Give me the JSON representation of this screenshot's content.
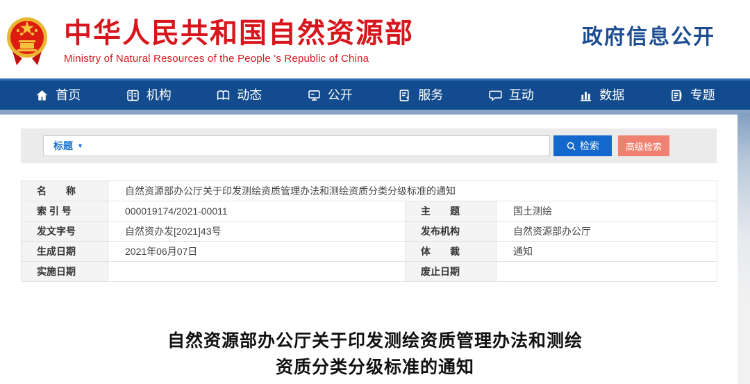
{
  "header": {
    "site_title": "中华人民共和国自然资源部",
    "site_subtitle": "Ministry of Natural Resources of the People 's Republic of China",
    "section_title": "政府信息公开"
  },
  "nav": {
    "items": [
      {
        "label": "首页",
        "icon": "home-icon"
      },
      {
        "label": "机构",
        "icon": "organization-icon"
      },
      {
        "label": "动态",
        "icon": "news-book-icon"
      },
      {
        "label": "公开",
        "icon": "disclosure-monitor-icon"
      },
      {
        "label": "服务",
        "icon": "service-document-icon"
      },
      {
        "label": "互动",
        "icon": "interaction-chat-icon"
      },
      {
        "label": "数据",
        "icon": "data-chart-icon"
      },
      {
        "label": "专题",
        "icon": "topics-journal-icon"
      }
    ]
  },
  "search": {
    "field_selector": "标题",
    "dropdown_arrow": "▼",
    "input_value": "",
    "search_button": "检索",
    "advanced_button": "高级检索"
  },
  "metadata": {
    "name_label": "名　　称",
    "name_value": "自然资源部办公厅关于印发测绘资质管理办法和测绘资质分类分级标准的通知",
    "rows": [
      {
        "label1": "索 引 号",
        "value1": "000019174/2021-00011",
        "label2": "主　　题",
        "value2": "国土测绘"
      },
      {
        "label1": "发文字号",
        "value1": "自然资办发[2021]43号",
        "label2": "发布机构",
        "value2": "自然资源部办公厅"
      },
      {
        "label1": "生成日期",
        "value1": "2021年06月07日",
        "label2": "体　　裁",
        "value2": "通知"
      },
      {
        "label1": "实施日期",
        "value1": "",
        "label2": "废止日期",
        "value2": ""
      }
    ]
  },
  "document": {
    "title_line1": "自然资源部办公厅关于印发测绘资质管理办法和测绘",
    "title_line2": "资质分类分级标准的通知"
  },
  "colors": {
    "brand_red": "#d8151c",
    "navy_blue": "#1c4d92",
    "nav_blue": "#134c8e",
    "nav_strip": "#8ba6c5",
    "search_button_blue": "#1268cc",
    "advanced_button_coral": "#f08170",
    "label_cell_gray": "#f4f4f4"
  }
}
